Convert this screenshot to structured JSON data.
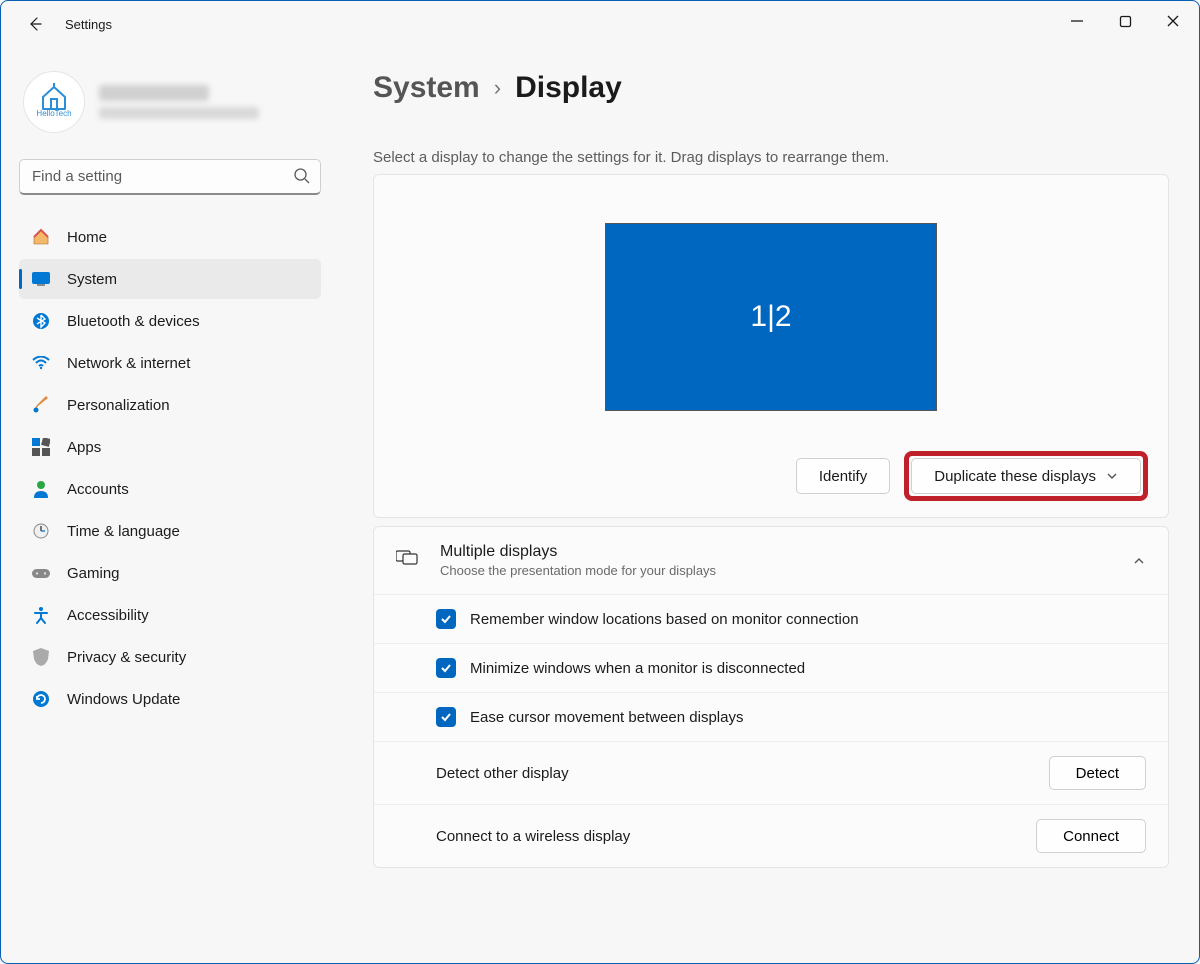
{
  "window": {
    "title": "Settings"
  },
  "account": {
    "avatar_label": "HelloTech"
  },
  "search": {
    "placeholder": "Find a setting"
  },
  "nav": [
    {
      "key": "home",
      "label": "Home"
    },
    {
      "key": "system",
      "label": "System"
    },
    {
      "key": "bluetooth",
      "label": "Bluetooth & devices"
    },
    {
      "key": "network",
      "label": "Network & internet"
    },
    {
      "key": "personalization",
      "label": "Personalization"
    },
    {
      "key": "apps",
      "label": "Apps"
    },
    {
      "key": "accounts",
      "label": "Accounts"
    },
    {
      "key": "time",
      "label": "Time & language"
    },
    {
      "key": "gaming",
      "label": "Gaming"
    },
    {
      "key": "accessibility",
      "label": "Accessibility"
    },
    {
      "key": "privacy",
      "label": "Privacy & security"
    },
    {
      "key": "update",
      "label": "Windows Update"
    }
  ],
  "breadcrumb": {
    "parent": "System",
    "current": "Display"
  },
  "helper": "Select a display to change the settings for it. Drag displays to rearrange them.",
  "monitor_label": "1|2",
  "identify_button": "Identify",
  "mode_dropdown": "Duplicate these displays",
  "multiple_displays": {
    "title": "Multiple displays",
    "subtitle": "Choose the presentation mode for your displays",
    "opt_remember": "Remember window locations based on monitor connection",
    "opt_minimize": "Minimize windows when a monitor is disconnected",
    "opt_ease": "Ease cursor movement between displays",
    "detect_label": "Detect other display",
    "detect_button": "Detect",
    "wireless_label": "Connect to a wireless display",
    "wireless_button": "Connect"
  }
}
